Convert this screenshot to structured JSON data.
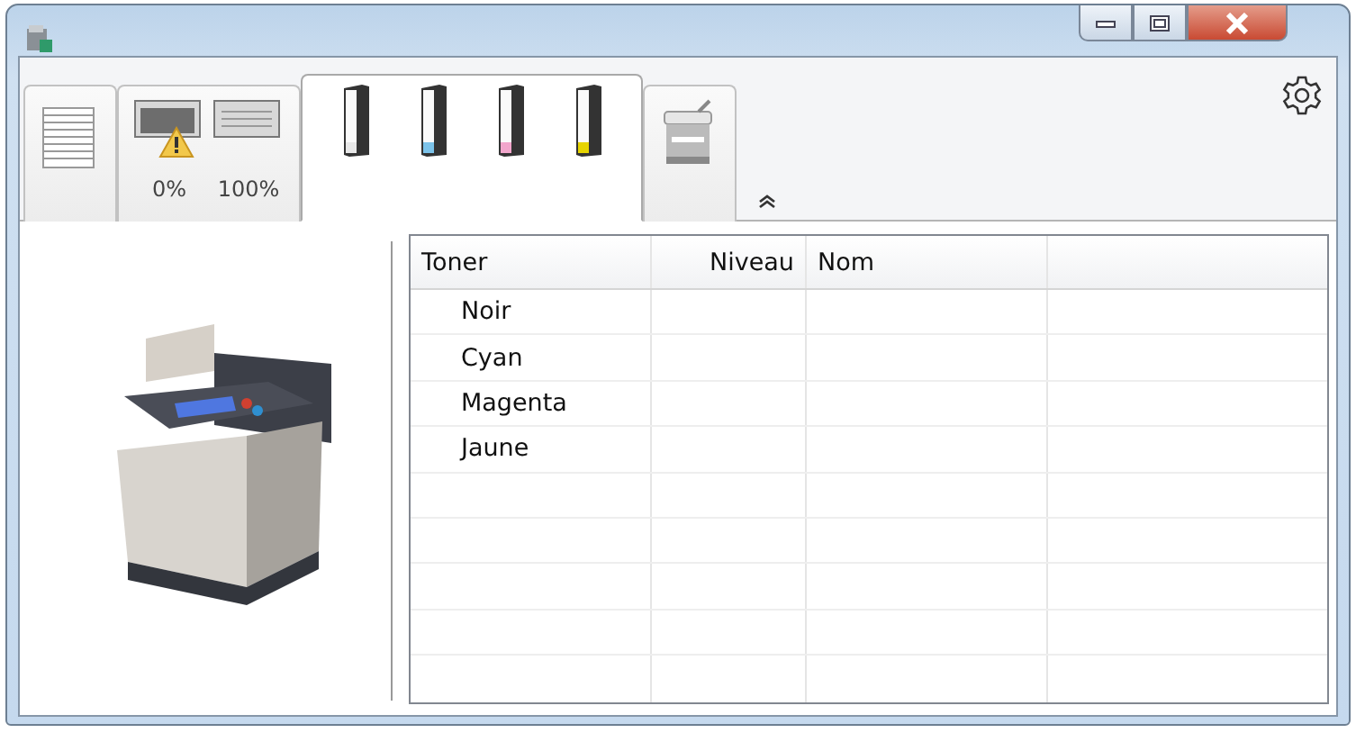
{
  "window": {
    "controls": [
      {
        "kind": "minimize"
      },
      {
        "kind": "maximize"
      },
      {
        "kind": "close"
      }
    ]
  },
  "tabs": [
    {
      "kind": "paper",
      "selected": false
    },
    {
      "kind": "trays",
      "selected": false,
      "trays": [
        {
          "label": "0%",
          "warning": true
        },
        {
          "label": "100%",
          "warning": false
        }
      ]
    },
    {
      "kind": "toners",
      "selected": true,
      "cartridges": [
        {
          "color": "#e8e8e8"
        },
        {
          "color": "#7cc3ea"
        },
        {
          "color": "#f2a6cc"
        },
        {
          "color": "#e6d400"
        }
      ]
    },
    {
      "kind": "device",
      "selected": false
    }
  ],
  "table": {
    "columns": [
      "Toner",
      "Niveau",
      "Nom"
    ],
    "rows": [
      {
        "toner": "Noir"
      },
      {
        "toner": "Cyan"
      },
      {
        "toner": "Magenta"
      },
      {
        "toner": "Jaune"
      }
    ]
  }
}
